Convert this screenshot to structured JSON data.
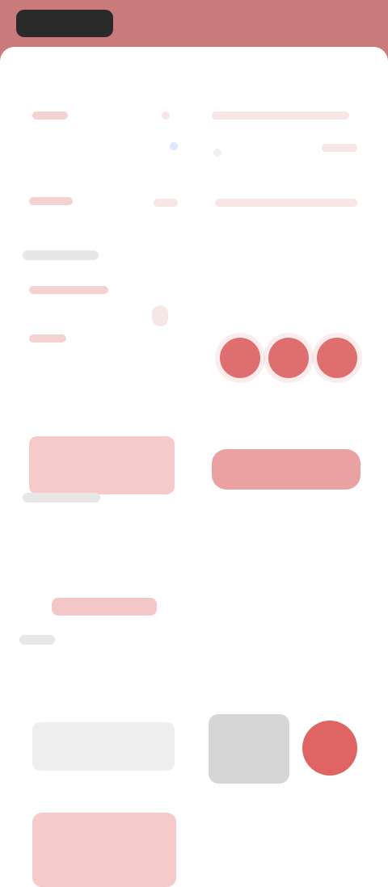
{
  "topbar": {
    "left_pill_text": "",
    "right_text": ""
  },
  "rows": {
    "row1_left": "",
    "row2_left": ""
  },
  "sections": {
    "section1_title": "",
    "section2_title": "",
    "section3_title": ""
  },
  "controls": {
    "left_block_text": "",
    "red_pill_text": "",
    "action_link_text": "",
    "fab_symbol": ""
  },
  "colors": {
    "topbar": "#c97a7a",
    "accent_red": "#e06464",
    "soft_red": "#f4caca",
    "gray": "#eeeeee"
  }
}
